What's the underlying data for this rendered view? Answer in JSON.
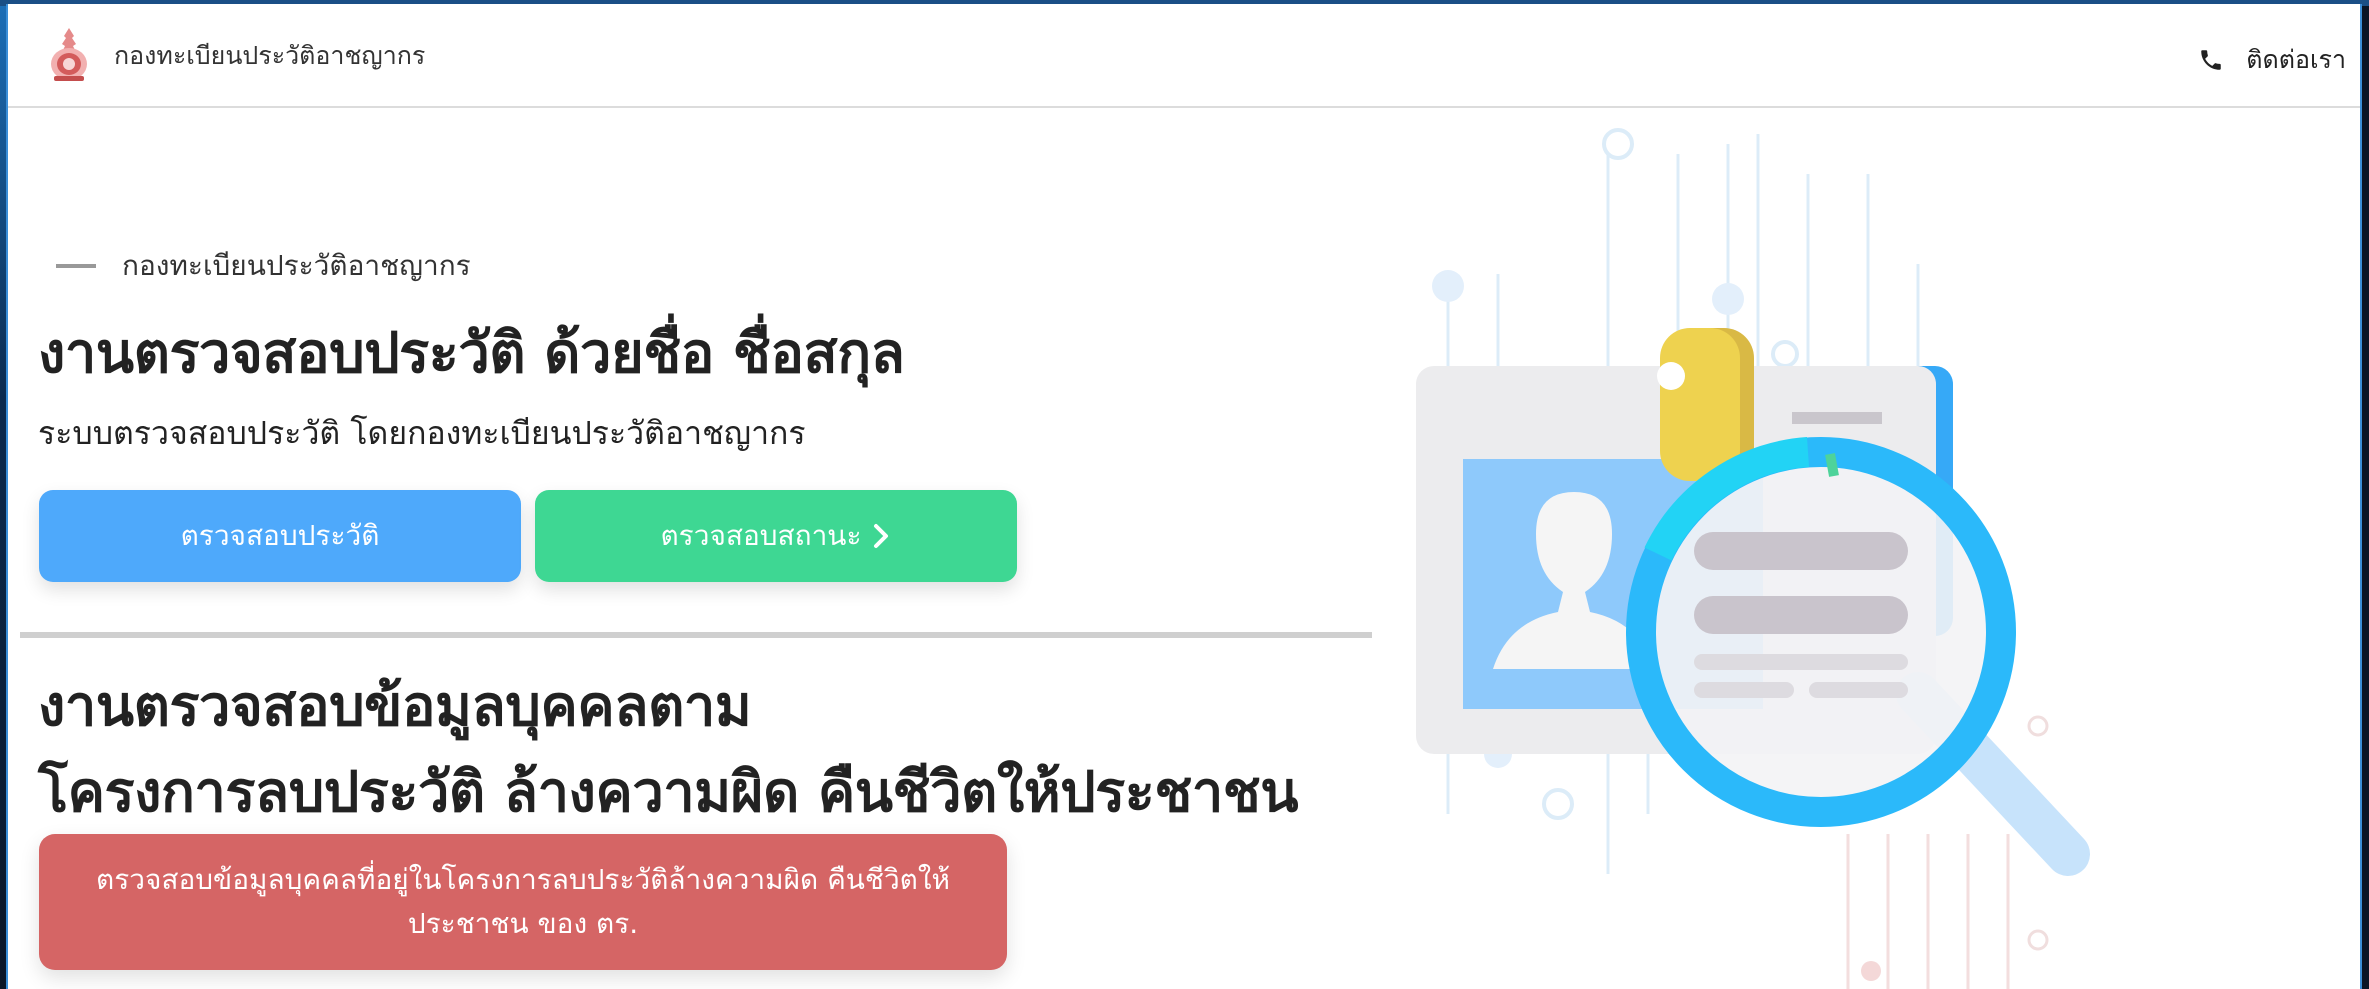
{
  "header": {
    "brand": "กองทะเบียนประวัติอาชญากร",
    "contact_label": "ติดต่อเรา",
    "contact_icon": "phone-icon"
  },
  "hero": {
    "eyebrow": "กองทะเบียนประวัติอาชญากร",
    "title": "งานตรวจสอบประวัติ ด้วยชื่อ ชื่อสกุล",
    "subtitle": "ระบบตรวจสอบประวัติ โดยกองทะเบียนประวัติอาชญากร",
    "button_check_history": "ตรวจสอบประวัติ",
    "button_check_status": "ตรวจสอบสถานะ",
    "button_check_status_icon": "chevron-right-icon"
  },
  "section2": {
    "title_line1": "งานตรวจสอบข้อมูลบุคคลตาม",
    "title_line2": "โครงการลบประวัติ ล้างความผิด คืนชีวิตให้ประชาชน",
    "button_label": "ตรวจสอบข้อมูลบุคคลที่อยู่ในโครงการลบประวัติล้างความผิด คืนชีวิตให้ประชาชน ของ ตร."
  },
  "illustration": {
    "icon": "id-card-magnifier-illustration"
  },
  "colors": {
    "blue": "#4ea9fb",
    "green": "#3ed793",
    "red": "#d56565"
  }
}
